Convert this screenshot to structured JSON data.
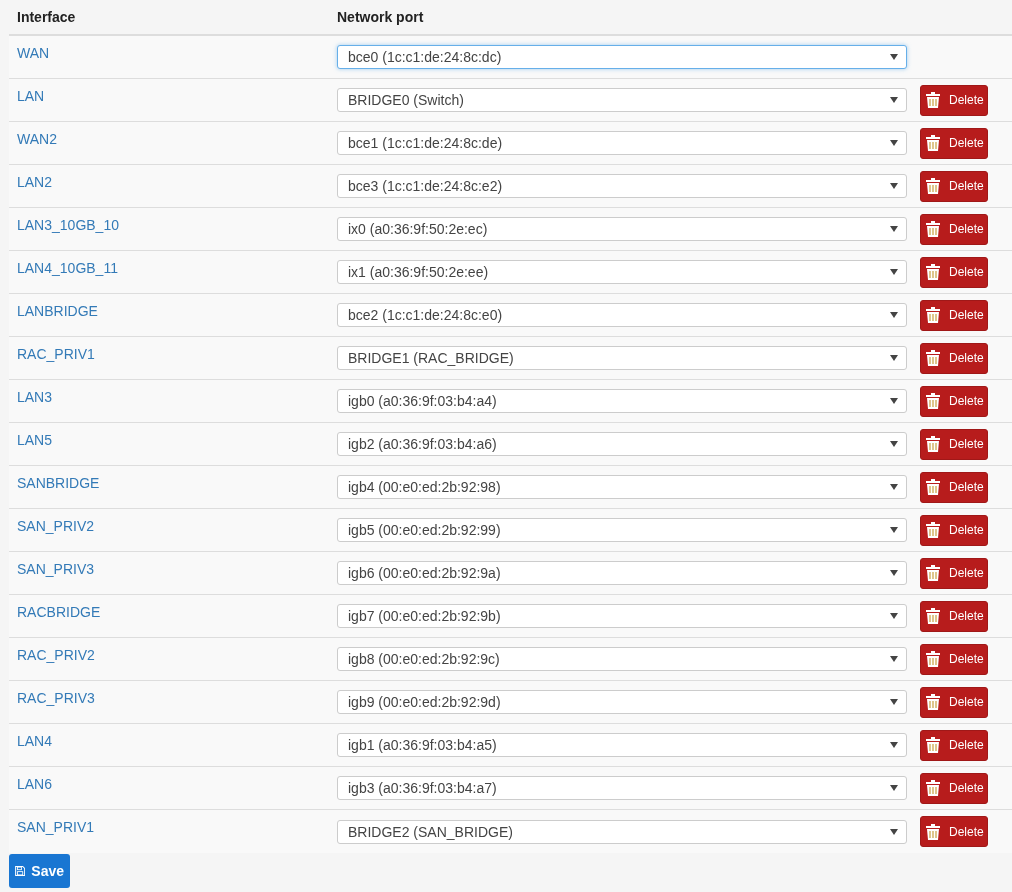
{
  "table": {
    "columns": [
      "Interface",
      "Network port"
    ],
    "rows": [
      {
        "interface": "WAN",
        "port": "bce0 (1c:c1:de:24:8c:dc)",
        "focused": true
      },
      {
        "interface": "LAN",
        "port": "BRIDGE0 (Switch)",
        "focused": false,
        "delete": "Delete"
      },
      {
        "interface": "WAN2",
        "port": "bce1 (1c:c1:de:24:8c:de)",
        "focused": false,
        "delete": "Delete"
      },
      {
        "interface": "LAN2",
        "port": "bce3 (1c:c1:de:24:8c:e2)",
        "focused": false,
        "delete": "Delete"
      },
      {
        "interface": "LAN3_10GB_10",
        "port": "ix0 (a0:36:9f:50:2e:ec)",
        "focused": false,
        "delete": "Delete"
      },
      {
        "interface": "LAN4_10GB_11",
        "port": "ix1 (a0:36:9f:50:2e:ee)",
        "focused": false,
        "delete": "Delete"
      },
      {
        "interface": "LANBRIDGE",
        "port": "bce2 (1c:c1:de:24:8c:e0)",
        "focused": false,
        "delete": "Delete"
      },
      {
        "interface": "RAC_PRIV1",
        "port": "BRIDGE1 (RAC_BRIDGE)",
        "focused": false,
        "delete": "Delete"
      },
      {
        "interface": "LAN3",
        "port": "igb0 (a0:36:9f:03:b4:a4)",
        "focused": false,
        "delete": "Delete"
      },
      {
        "interface": "LAN5",
        "port": "igb2 (a0:36:9f:03:b4:a6)",
        "focused": false,
        "delete": "Delete"
      },
      {
        "interface": "SANBRIDGE",
        "port": "igb4 (00:e0:ed:2b:92:98)",
        "focused": false,
        "delete": "Delete"
      },
      {
        "interface": "SAN_PRIV2",
        "port": "igb5 (00:e0:ed:2b:92:99)",
        "focused": false,
        "delete": "Delete"
      },
      {
        "interface": "SAN_PRIV3",
        "port": "igb6 (00:e0:ed:2b:92:9a)",
        "focused": false,
        "delete": "Delete"
      },
      {
        "interface": "RACBRIDGE",
        "port": "igb7 (00:e0:ed:2b:92:9b)",
        "focused": false,
        "delete": "Delete"
      },
      {
        "interface": "RAC_PRIV2",
        "port": "igb8 (00:e0:ed:2b:92:9c)",
        "focused": false,
        "delete": "Delete"
      },
      {
        "interface": "RAC_PRIV3",
        "port": "igb9 (00:e0:ed:2b:92:9d)",
        "focused": false,
        "delete": "Delete"
      },
      {
        "interface": "LAN4",
        "port": "igb1 (a0:36:9f:03:b4:a5)",
        "focused": false,
        "delete": "Delete"
      },
      {
        "interface": "LAN6",
        "port": "igb3 (a0:36:9f:03:b4:a7)",
        "focused": false,
        "delete": "Delete"
      },
      {
        "interface": "SAN_PRIV1",
        "port": "BRIDGE2 (SAN_BRIDGE)",
        "focused": false,
        "delete": "Delete"
      }
    ]
  },
  "save_button": "Save"
}
